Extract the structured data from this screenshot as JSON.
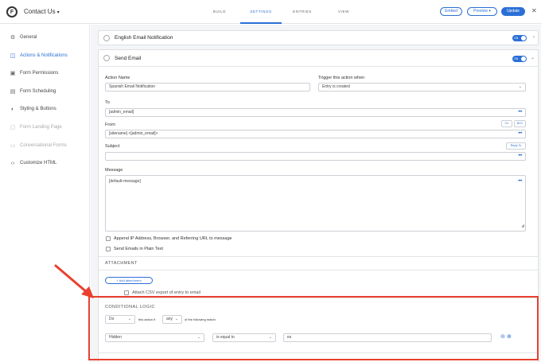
{
  "header": {
    "form_title": "Contact Us",
    "tabs": [
      {
        "label": "BUILD",
        "active": false
      },
      {
        "label": "SETTINGS",
        "active": true
      },
      {
        "label": "ENTRIES",
        "active": false
      },
      {
        "label": "VIEW",
        "active": false
      }
    ],
    "embed_label": "Embed",
    "preview_label": "Preview",
    "update_label": "Update",
    "close_label": "✕"
  },
  "sidebar": {
    "items": [
      {
        "label": "General",
        "icon": "gear-icon",
        "active": false,
        "disabled": false
      },
      {
        "label": "Actions & Notifications",
        "icon": "bell-icon",
        "active": true,
        "disabled": false
      },
      {
        "label": "Form Permissions",
        "icon": "lock-icon",
        "active": false,
        "disabled": false
      },
      {
        "label": "Form Scheduling",
        "icon": "calendar-icon",
        "active": false,
        "disabled": false
      },
      {
        "label": "Styling & Buttons",
        "icon": "palette-icon",
        "active": false,
        "disabled": false
      },
      {
        "label": "Form Landing Page",
        "icon": "page-icon",
        "active": false,
        "disabled": true
      },
      {
        "label": "Conversational Forms",
        "icon": "chat-icon",
        "active": false,
        "disabled": true
      },
      {
        "label": "Customize HTML",
        "icon": "code-icon",
        "active": false,
        "disabled": false
      }
    ]
  },
  "actions": {
    "english_title": "English Email Notification",
    "send_email_title": "Send Email",
    "toggle_label": "ON",
    "action_name_label": "Action Name",
    "action_name_value": "Spanish Email Notification",
    "trigger_label": "Trigger this action when",
    "trigger_value": "Entry is created",
    "to_label": "To",
    "to_value": "[admin_email]",
    "from_label": "From",
    "from_value": "[sitename] <[admin_email]>",
    "cc_label": "CC",
    "bcc_label": "BCC",
    "subject_label": "Subject",
    "subject_value": "",
    "reply_to_label": "Reply To",
    "message_label": "Message",
    "message_value": "[default-message]",
    "append_ip_label": "Append IP Address, Browser, and Referring URL to message",
    "plain_text_label": "Send Emails in Plain Text",
    "attachment_title": "ATTACHMENT",
    "add_attachment_label": "+ Add attachment",
    "attach_csv_label": "Attach CSV export of entry to email",
    "dots": "•••"
  },
  "conditional": {
    "title": "CONDITIONAL LOGIC",
    "do_value": "Do",
    "this_action_if": "this action if",
    "any_value": "any",
    "of_following": "of the following match:",
    "field_value": "Hidden",
    "operator_value": "is equal to",
    "compare_value": "es"
  },
  "accent_color": "#2b6fd6",
  "highlight_color": "#e9402f"
}
